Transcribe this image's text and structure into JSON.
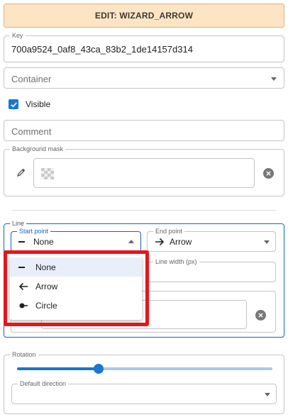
{
  "header": {
    "title": "EDIT: WIZARD_ARROW"
  },
  "key": {
    "label": "Key",
    "value": "700a9524_0af8_43ca_83b2_1de14157d314"
  },
  "container": {
    "placeholder": "Container"
  },
  "visible": {
    "label": "Visible",
    "checked": true
  },
  "comment": {
    "placeholder": "Comment"
  },
  "background_mask": {
    "label": "Background mask"
  },
  "line": {
    "label": "Line",
    "start_point": {
      "label": "Start point",
      "value": "None"
    },
    "end_point": {
      "label": "End point",
      "value": "Arrow"
    },
    "line_width": {
      "label": "Line width (px)"
    }
  },
  "dropdown": {
    "options": [
      {
        "label": "None",
        "icon": "dash-icon",
        "selected": true
      },
      {
        "label": "Arrow",
        "icon": "arrow-left-icon",
        "selected": false
      },
      {
        "label": "Circle",
        "icon": "circle-end-icon",
        "selected": false
      }
    ]
  },
  "rotation": {
    "label": "Rotation",
    "slider_value": 0.32,
    "default_direction": {
      "label": "Default direction"
    }
  },
  "colors": {
    "header_bg": "#fde4c3",
    "accent": "#1976d2",
    "highlight": "#e8141a"
  }
}
